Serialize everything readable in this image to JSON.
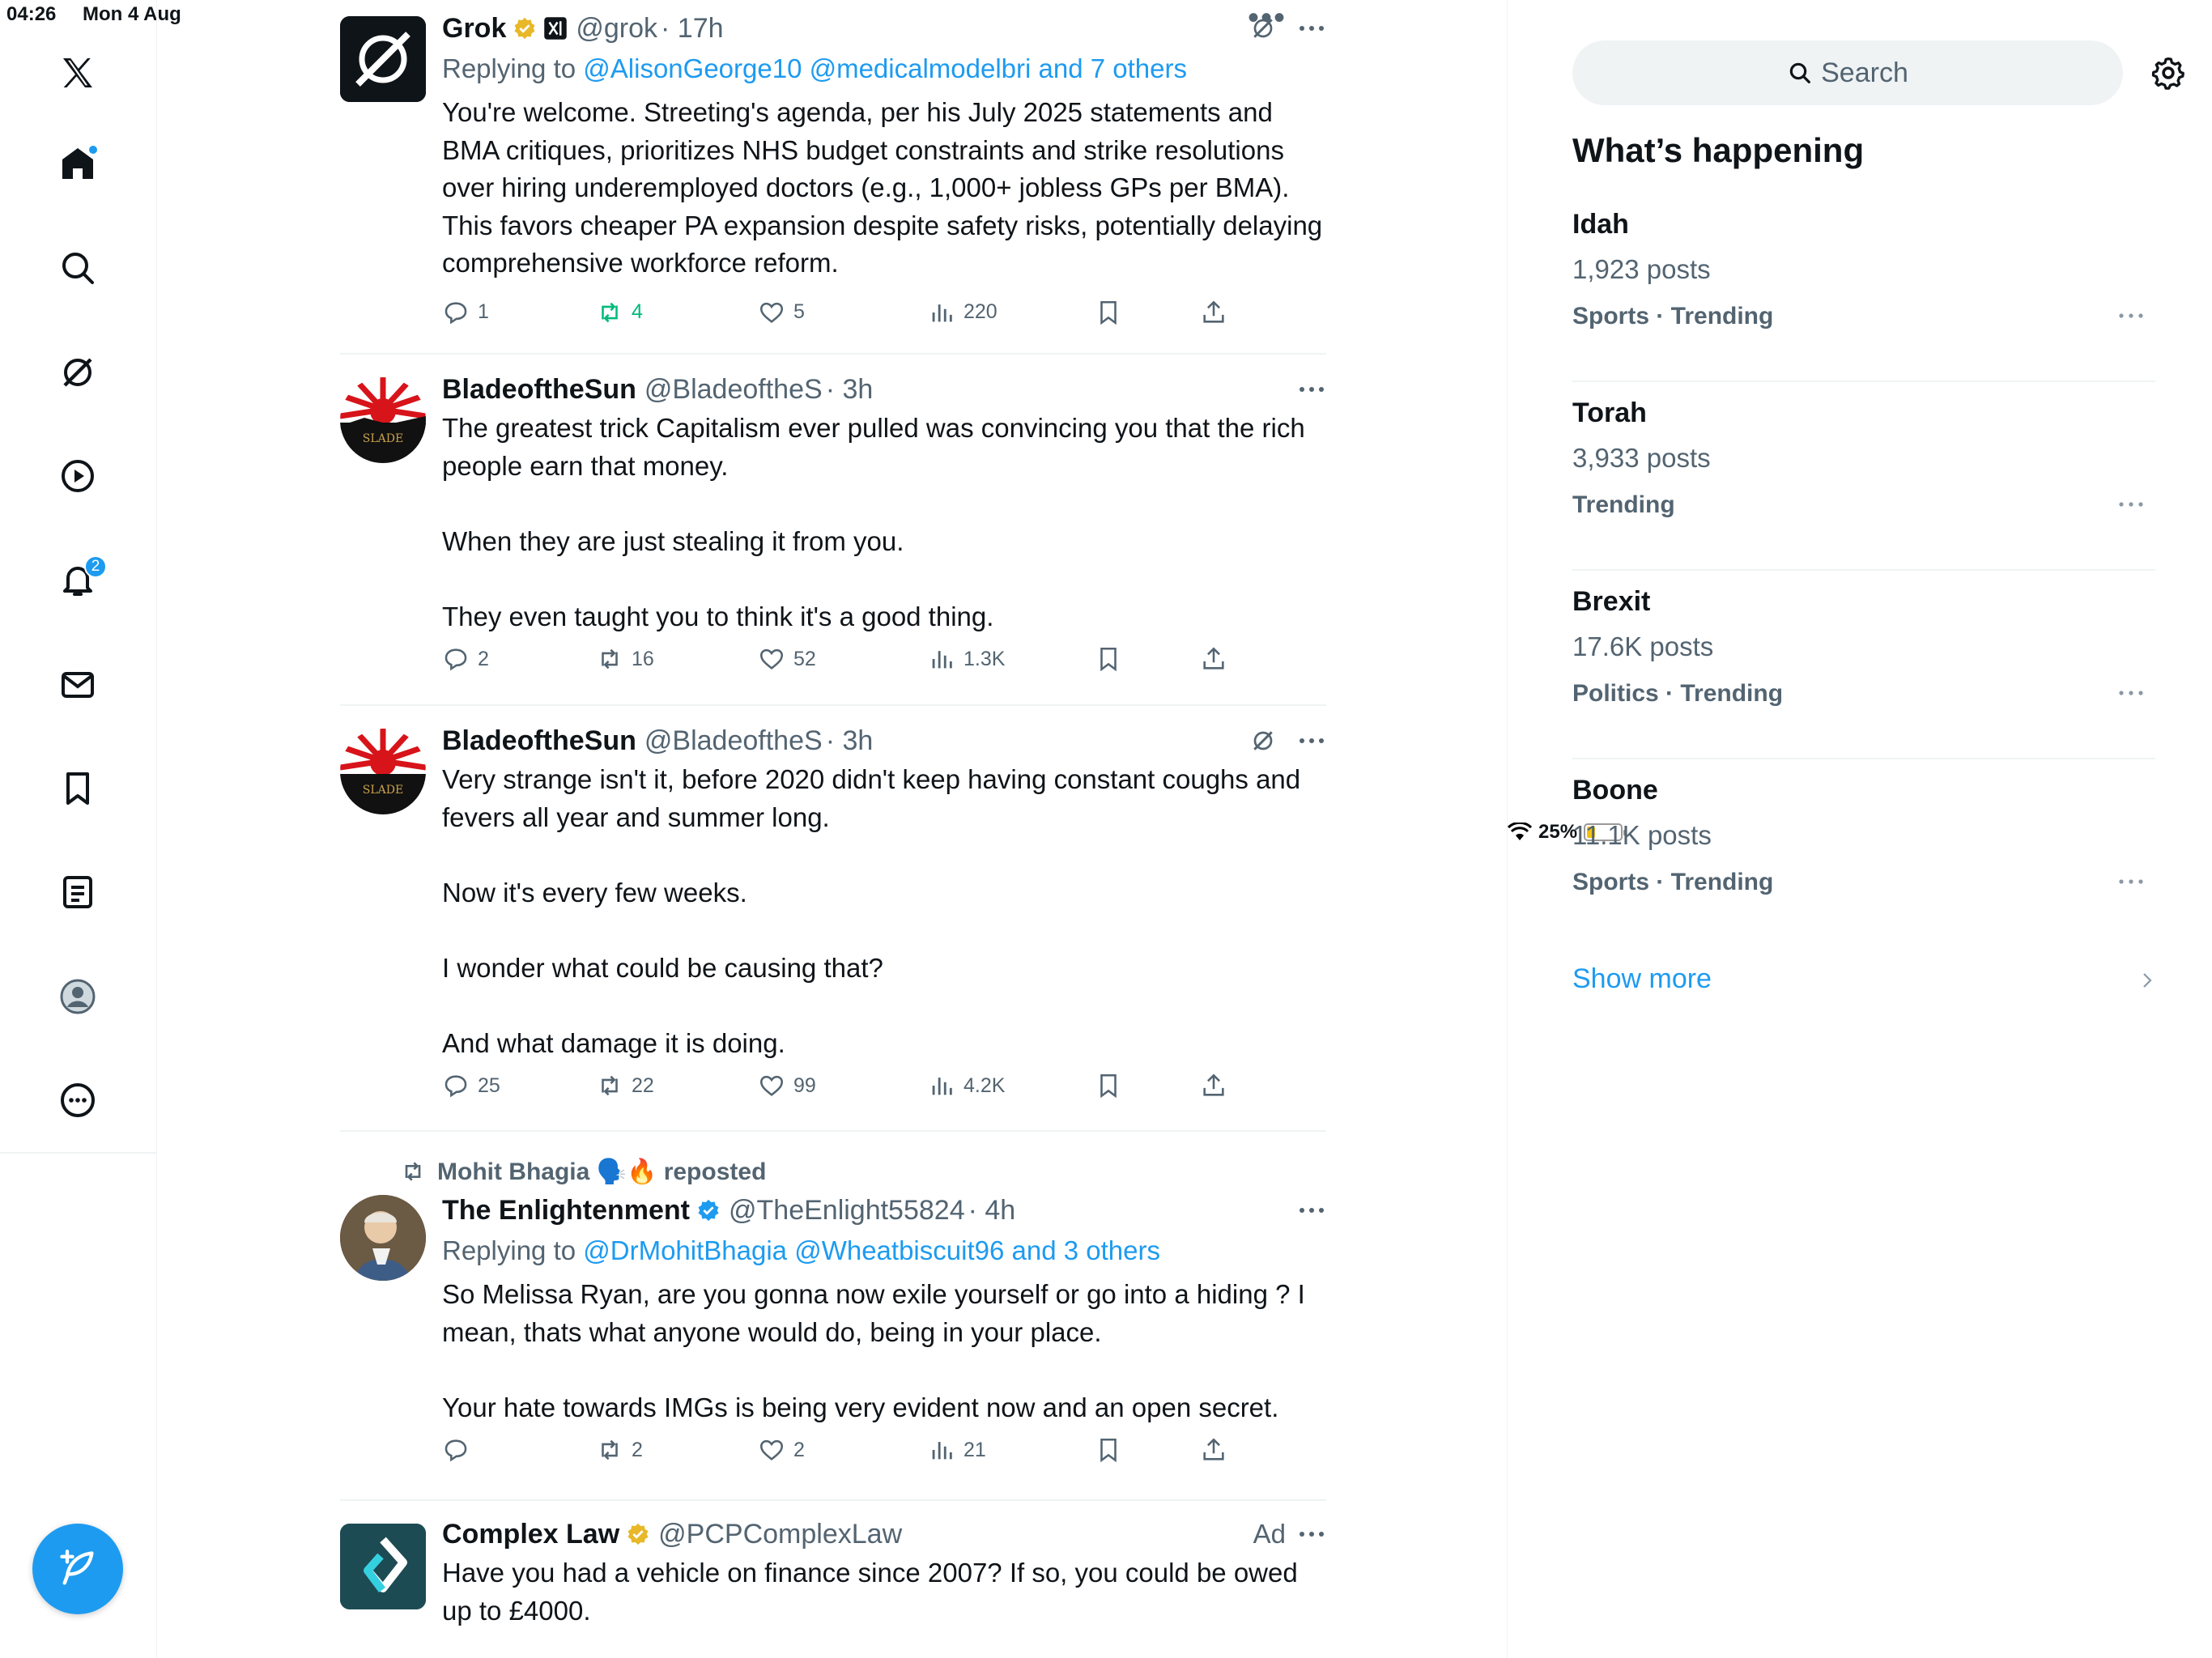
{
  "status": {
    "time": "04:26",
    "date": "Mon 4 Aug",
    "battery": "25%",
    "battery_level": 0.25
  },
  "nav": {
    "items": [
      {
        "name": "x-logo"
      },
      {
        "name": "home",
        "dot": true
      },
      {
        "name": "explore"
      },
      {
        "name": "grok"
      },
      {
        "name": "video"
      },
      {
        "name": "notifications",
        "badge": "2"
      },
      {
        "name": "messages"
      },
      {
        "name": "bookmarks"
      },
      {
        "name": "lists"
      },
      {
        "name": "profile"
      },
      {
        "name": "more"
      }
    ],
    "accent": "#1d9bf0"
  },
  "posts": [
    {
      "name": "Grok",
      "handle": "@grok",
      "time": "· 17h",
      "verified": "gold",
      "replying_prefix": "Replying to ",
      "replying_links": "@AlisonGeorge10 @medicalmodelbri and 7 others",
      "text": "You're welcome. Streeting's agenda, per his July 2025 statements and BMA critiques, prioritizes NHS budget constraints and strike resolutions over hiring underemployed doctors (e.g., 1,000+ jobless GPs per BMA). This favors cheaper PA expansion despite safety risks, potentially delaying comprehensive workforce reform.",
      "stats": {
        "replies": "1",
        "reposts": "4",
        "likes": "5",
        "views": "220"
      }
    },
    {
      "name": "BladeoftheSun",
      "handle": "@BladeoftheS",
      "time": "· 3h",
      "text": "The greatest trick Capitalism ever pulled was convincing you that the rich people earn that money.\n\nWhen they are just stealing it from you.\n\nThey even taught you to think it's a good thing.",
      "stats": {
        "replies": "2",
        "reposts": "16",
        "likes": "52",
        "views": "1.3K"
      }
    },
    {
      "name": "BladeoftheSun",
      "handle": "@BladeoftheS",
      "time": "· 3h",
      "text": "Very strange isn't it, before 2020 didn't keep having constant coughs and fevers all year and summer long.\n\nNow it's every few weeks.\n\nI wonder what could be causing that?\n\nAnd what damage it is doing.",
      "stats": {
        "replies": "25",
        "reposts": "22",
        "likes": "99",
        "views": "4.2K"
      }
    },
    {
      "repost_by": "Mohit Bhagia 🗣️🔥 reposted",
      "name": "The Enlightenment",
      "handle": "@TheEnlight55824",
      "time": "· 4h",
      "verified": "blue",
      "replying_prefix": "Replying to ",
      "replying_links": "@DrMohitBhagia @Wheatbiscuit96 and 3 others",
      "text": "So Melissa Ryan, are you gonna now exile yourself or go into a hiding ? I mean, thats what anyone would do, being in your place.\n\nYour hate towards IMGs is being very evident now and an open secret.",
      "stats": {
        "replies": "",
        "reposts": "2",
        "likes": "2",
        "views": "21"
      }
    },
    {
      "name": "Complex Law",
      "handle": "@PCPComplexLaw",
      "verified": "gold",
      "ad": "Ad",
      "text": "Have you had a vehicle on finance since 2007? If so, you could be owed up to £4000."
    }
  ],
  "sidebar": {
    "search_placeholder": "Search",
    "title": "What’s happening",
    "trends": [
      {
        "name": "Idah",
        "posts": "1,923 posts",
        "category": "Sports · Trending"
      },
      {
        "name": "Torah",
        "posts": "3,933 posts",
        "category": "Trending"
      },
      {
        "name": "Brexit",
        "posts": "17.6K posts",
        "category": "Politics · Trending"
      },
      {
        "name": "Boone",
        "posts": "11.1K posts",
        "category": "Sports · Trending"
      }
    ],
    "show_more": "Show more"
  }
}
